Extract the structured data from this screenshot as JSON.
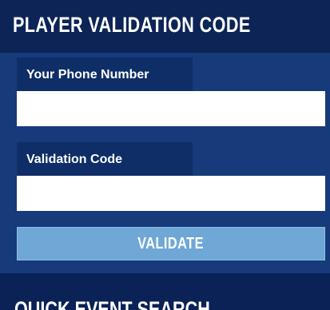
{
  "header": {
    "title": "PLAYER VALIDATION CODE"
  },
  "form": {
    "phone": {
      "label": "Your Phone Number",
      "value": "",
      "placeholder": ""
    },
    "code": {
      "label": "Validation Code",
      "value": "",
      "placeholder": ""
    },
    "validate_label": "VALIDATE"
  },
  "next_section": {
    "title": "QUICK EVENT SEARCH"
  },
  "colors": {
    "header_bg": "#0c2456",
    "panel_bg": "#173a7a",
    "label_bg": "#0f2e68",
    "button_bg": "#6fa7d6"
  }
}
